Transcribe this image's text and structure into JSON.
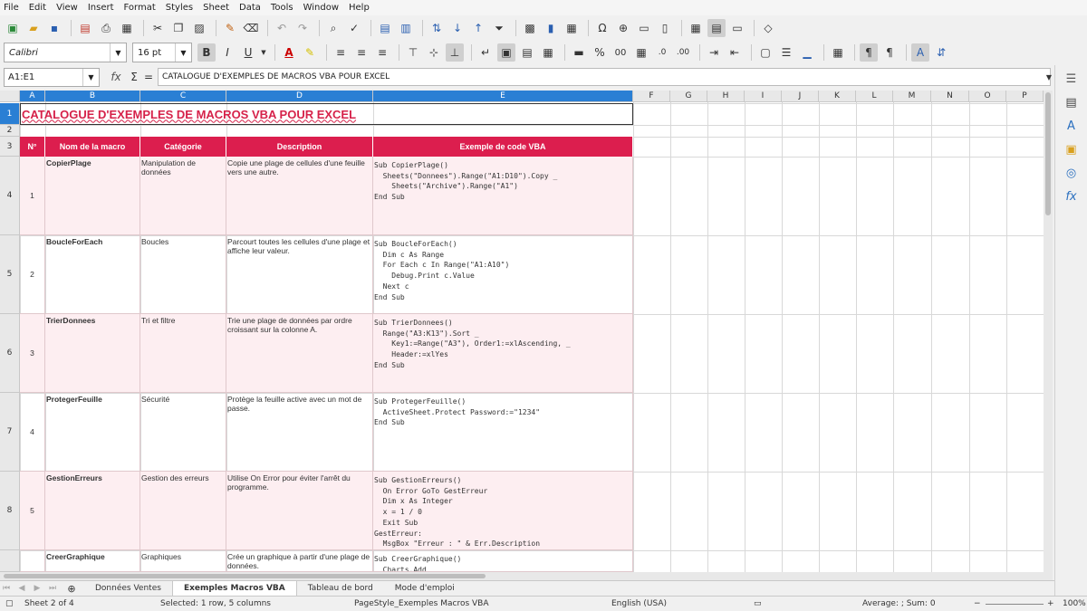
{
  "menu": [
    "File",
    "Edit",
    "View",
    "Insert",
    "Format",
    "Styles",
    "Sheet",
    "Data",
    "Tools",
    "Window",
    "Help"
  ],
  "toolbar": {
    "font_name": "Calibri",
    "font_size": "16 pt",
    "bold": "B",
    "italic": "I",
    "underline": "U",
    "percent": "%",
    "decimal": "0.0",
    "decimal_add": "00"
  },
  "formula_bar": {
    "name_box": "A1:E1",
    "formula": "CATALOGUE D'EXEMPLES DE MACROS VBA POUR EXCEL"
  },
  "columns": [
    "A",
    "B",
    "C",
    "D",
    "E",
    "F",
    "G",
    "H",
    "I",
    "J",
    "K",
    "L",
    "M",
    "N",
    "O",
    "P"
  ],
  "rows": [
    "1",
    "2",
    "3",
    "4",
    "5",
    "6",
    "7",
    "8"
  ],
  "sheet": {
    "title": "CATALOGUE D'EXEMPLES DE MACROS VBA POUR EXCEL",
    "headers": [
      "N°",
      "Nom de la macro",
      "Catégorie",
      "Description",
      "Exemple de code VBA"
    ],
    "data_rows": [
      {
        "n": "1",
        "name": "CopierPlage",
        "category": "Manipulation de données",
        "description": "Copie une plage de cellules d'une feuille vers une autre.",
        "code": "Sub CopierPlage()\n  Sheets(\"Donnees\").Range(\"A1:D10\").Copy _\n    Sheets(\"Archive\").Range(\"A1\")\nEnd Sub"
      },
      {
        "n": "2",
        "name": "BoucleForEach",
        "category": "Boucles",
        "description": "Parcourt toutes les cellules d'une plage et affiche leur valeur.",
        "code": "Sub BoucleForEach()\n  Dim c As Range\n  For Each c In Range(\"A1:A10\")\n    Debug.Print c.Value\n  Next c\nEnd Sub"
      },
      {
        "n": "3",
        "name": "TrierDonnees",
        "category": "Tri et filtre",
        "description": "Trie une plage de données par ordre croissant sur la colonne A.",
        "code": "Sub TrierDonnees()\n  Range(\"A3:K13\").Sort _\n    Key1:=Range(\"A3\"), Order1:=xlAscending, _\n    Header:=xlYes\nEnd Sub"
      },
      {
        "n": "4",
        "name": "ProtegerFeuille",
        "category": "Sécurité",
        "description": "Protège la feuille active avec un mot de passe.",
        "code": "Sub ProtegerFeuille()\n  ActiveSheet.Protect Password:=\"1234\"\nEnd Sub"
      },
      {
        "n": "5",
        "name": "GestionErreurs",
        "category": "Gestion des erreurs",
        "description": "Utilise On Error pour éviter l'arrêt du programme.",
        "code": "Sub GestionErreurs()\n  On Error GoTo GestErreur\n  Dim x As Integer\n  x = 1 / 0\n  Exit Sub\nGestErreur:\n  MsgBox \"Erreur : \" & Err.Description"
      },
      {
        "n": "",
        "name": "CreerGraphique",
        "category": "Graphiques",
        "description": "Crée un graphique à partir d'une plage de données.",
        "code": "Sub CreerGraphique()\n  Charts.Add"
      }
    ]
  },
  "tabs": [
    "Données Ventes",
    "Exemples Macros VBA",
    "Tableau de bord",
    "Mode d'emploi"
  ],
  "status": {
    "sheet": "Sheet 2 of 4",
    "selection": "Selected: 1 row, 5 columns",
    "page_style": "PageStyle_Exemples Macros VBA",
    "language": "English (USA)",
    "summary": "Average: ; Sum: 0",
    "zoom": "100%"
  },
  "colors": {
    "accent": "#dc1e4e",
    "title": "#d6224a",
    "selection": "#2a7fd4",
    "row_pink": "#fdeef1"
  }
}
